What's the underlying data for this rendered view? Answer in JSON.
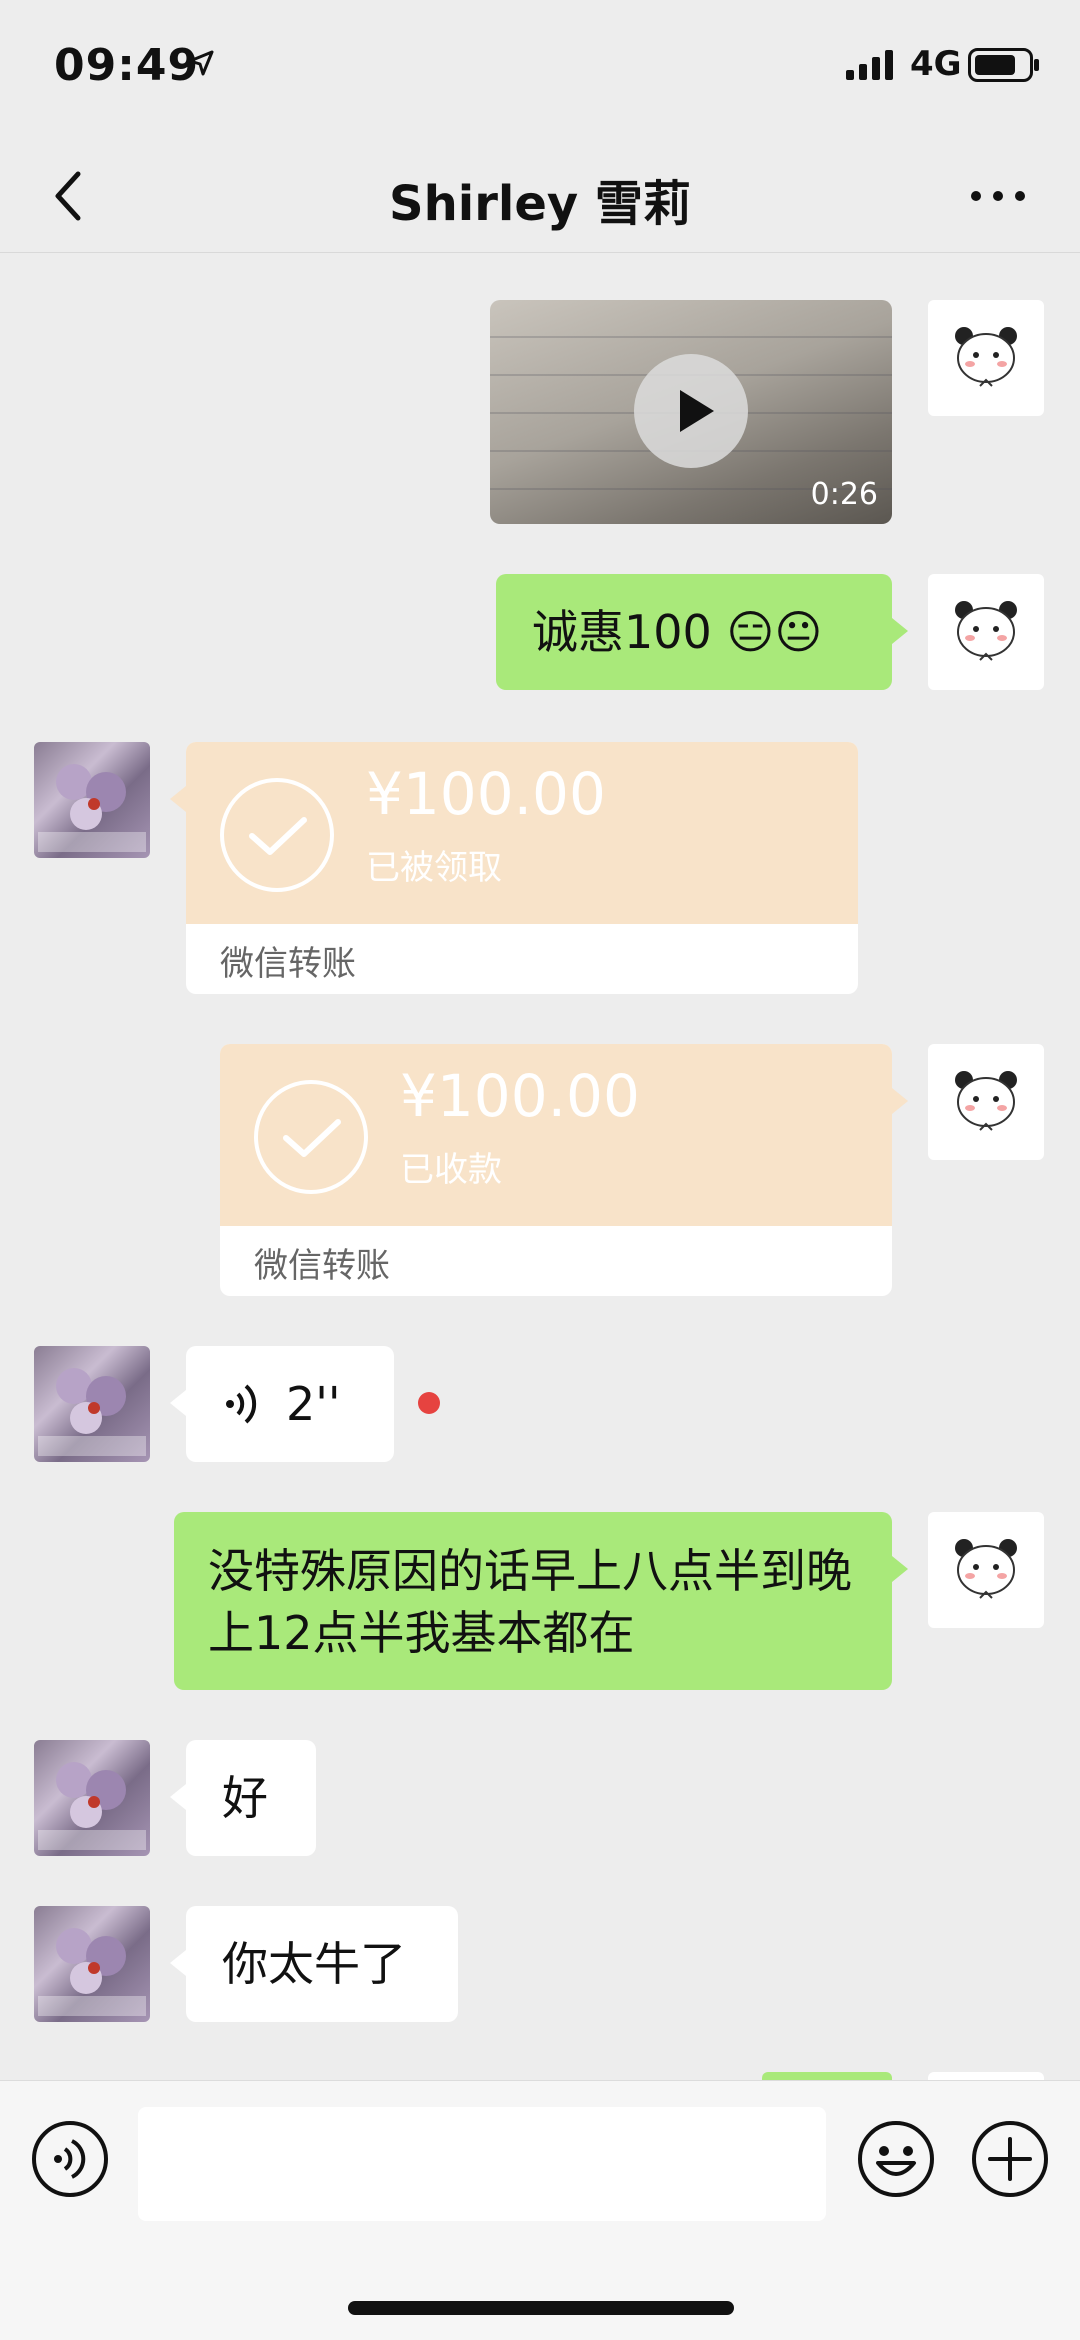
{
  "status_bar": {
    "time": "09:49",
    "network": "4G"
  },
  "nav": {
    "title": "Shirley 雪莉"
  },
  "messages": {
    "video_duration": "0:26",
    "text1": "诚惠100 😑😐",
    "transfer1": {
      "amount": "¥100.00",
      "status": "已被领取",
      "label": "微信转账"
    },
    "transfer2": {
      "amount": "¥100.00",
      "status": "已收款",
      "label": "微信转账"
    },
    "voice_length": "2''",
    "text2": "没特殊原因的话早上八点半到晚上12点半我基本都在",
    "text3": "好",
    "text4": "你太牛了"
  },
  "input": {
    "placeholder": ""
  },
  "colors": {
    "bubble_green": "#a9e97a",
    "transfer_peach": "#f8e3c9",
    "unread_red": "#e64340",
    "background": "#ededed"
  },
  "icons": [
    "location-arrow-icon",
    "signal-icon",
    "battery-icon",
    "back-chevron-icon",
    "more-dots-icon",
    "play-icon",
    "check-circle-icon",
    "voice-wave-icon",
    "voice-input-icon",
    "emoji-icon",
    "plus-icon"
  ]
}
